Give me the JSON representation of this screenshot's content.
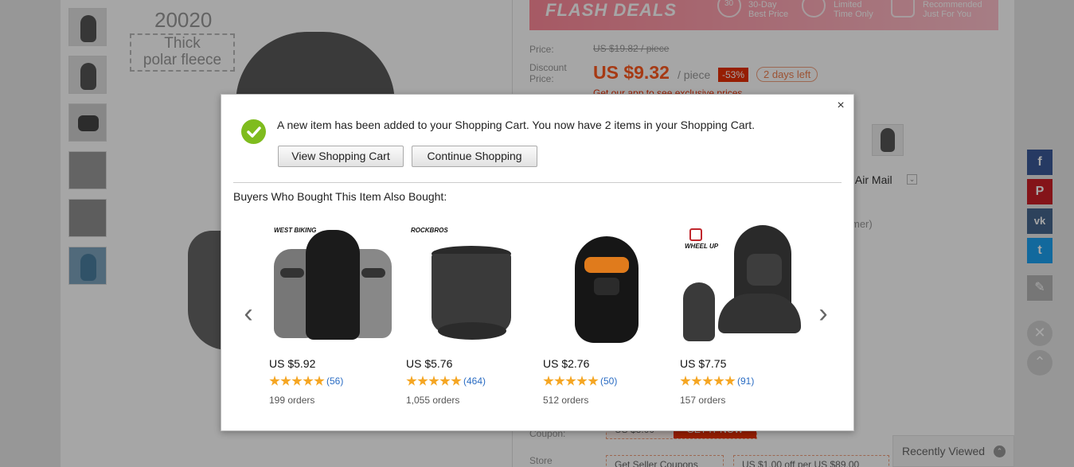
{
  "background": {
    "gallery": {
      "image_number": "20020",
      "image_caption_line1": "Thick",
      "image_caption_line2": "polar fleece"
    },
    "flash_banner": {
      "title": "FLASH DEALS",
      "feature_1_line1": "30-Day",
      "feature_1_line2": "Best Price",
      "feature_1_badge": "30",
      "feature_2_line1": "Limited",
      "feature_2_line2": "Time Only",
      "feature_3_line1": "Recommended",
      "feature_3_line2": "Just For You"
    },
    "price_label": "Price:",
    "old_price": "US $19.82 / piece",
    "discount_label_line1": "Discount",
    "discount_label_line2": "Price:",
    "new_price": "US $9.32",
    "per_piece": "/ piece",
    "discount_badge": "-53%",
    "days_left": "2 days left",
    "app_link": "Get our app to see exclusive prices",
    "shipping_text": "d Air Mail",
    "customer_text": "mer)",
    "coupon_label": "Coupon:",
    "coupon_value": "US $3.00",
    "coupon_get": "GET IT NOW",
    "store_label": "Store",
    "store_select": "Get Seller Coupons",
    "store_offer": "US $1.00 off per US $89.00",
    "recently_viewed": "Recently Viewed"
  },
  "share_bar": {
    "facebook": "f",
    "pinterest": "P",
    "vk": "vk",
    "twitter": "t",
    "edit": "✎",
    "close": "✕",
    "top": "⌃"
  },
  "modal": {
    "close": "×",
    "message": "A new item has been added to your Shopping Cart. You now have 2 items in your Shopping Cart.",
    "view_cart_label": "View Shopping Cart",
    "continue_label": "Continue Shopping",
    "also_bought_title": "Buyers Who Bought This Item Also Bought:",
    "arrow_left": "‹",
    "arrow_right": "›",
    "products": [
      {
        "brand": "WEST BIKING",
        "price": "US $5.92",
        "reviews": "(56)",
        "orders": "199 orders",
        "rating": 5
      },
      {
        "brand": "ROCKBROS",
        "price": "US $5.76",
        "reviews": "(464)",
        "orders": "1,055 orders",
        "rating": 5
      },
      {
        "brand": "",
        "price": "US $2.76",
        "reviews": "(50)",
        "orders": "512 orders",
        "rating": 5
      },
      {
        "brand": "WHEEL UP",
        "price": "US $7.75",
        "reviews": "(91)",
        "orders": "157 orders",
        "rating": 5
      }
    ]
  },
  "colors": {
    "accent_red": "#e62e04",
    "price_orange": "#ff5a1f",
    "check_green": "#7fbc1e",
    "star_orange": "#f5a623",
    "link_blue": "#2a6cc3",
    "facebook": "#3b5998",
    "pinterest": "#cb2027",
    "vk": "#45668e",
    "twitter": "#1da1f2"
  }
}
